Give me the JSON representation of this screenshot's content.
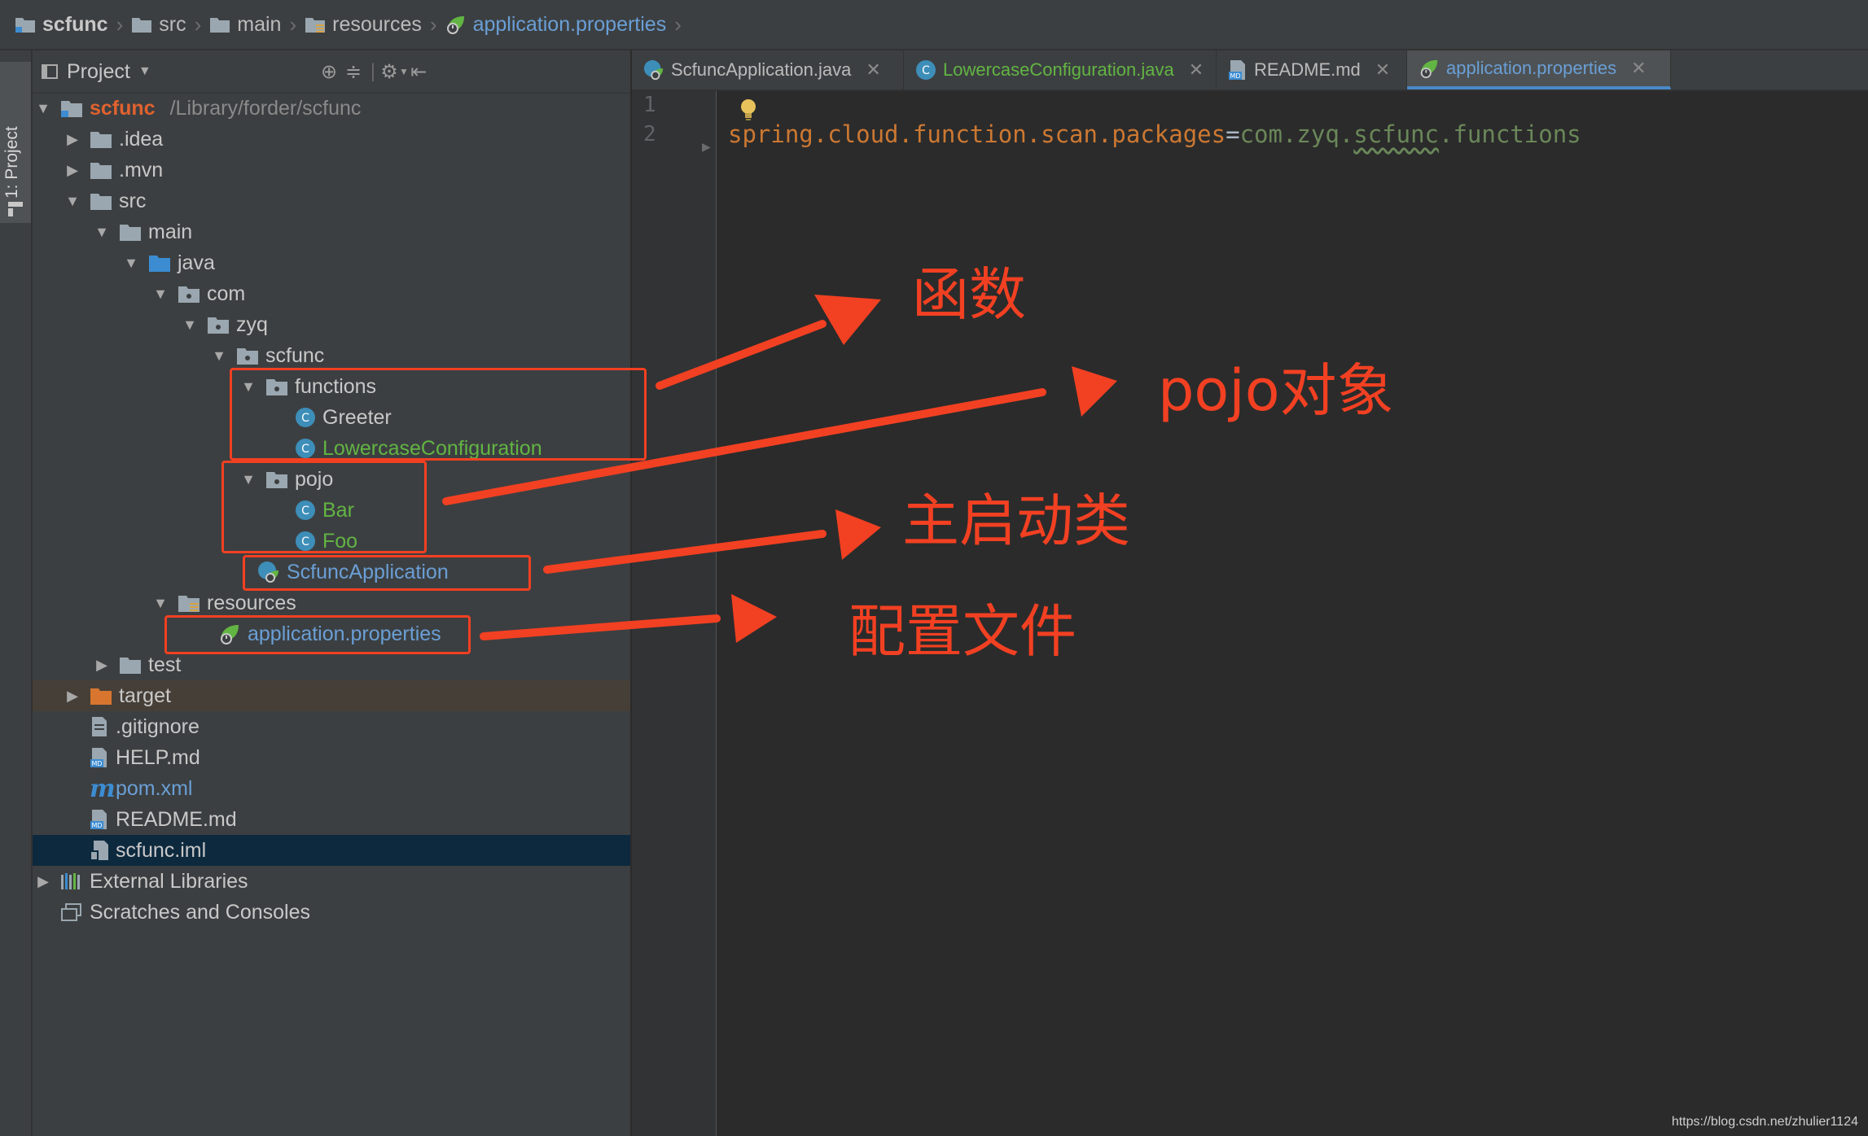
{
  "breadcrumb": {
    "items": [
      "scfunc",
      "src",
      "main",
      "resources",
      "application.properties"
    ]
  },
  "tool_strip": {
    "label": "1: Project"
  },
  "project_panel": {
    "title": "Project"
  },
  "tree": [
    {
      "label": "scfunc",
      "path": "/Library/forder/scfunc"
    },
    {
      "label": ".idea"
    },
    {
      "label": ".mvn"
    },
    {
      "label": "src"
    },
    {
      "label": "main"
    },
    {
      "label": "java"
    },
    {
      "label": "com"
    },
    {
      "label": "zyq"
    },
    {
      "label": "scfunc"
    },
    {
      "label": "functions"
    },
    {
      "label": "Greeter"
    },
    {
      "label": "LowercaseConfiguration"
    },
    {
      "label": "pojo"
    },
    {
      "label": "Bar"
    },
    {
      "label": "Foo"
    },
    {
      "label": "ScfuncApplication"
    },
    {
      "label": "resources"
    },
    {
      "label": "application.properties"
    },
    {
      "label": "test"
    },
    {
      "label": "target"
    },
    {
      "label": ".gitignore"
    },
    {
      "label": "HELP.md"
    },
    {
      "label": "pom.xml"
    },
    {
      "label": "README.md"
    },
    {
      "label": "scfunc.iml"
    },
    {
      "label": "External Libraries"
    },
    {
      "label": "Scratches and Consoles"
    }
  ],
  "tabs": [
    {
      "label": "ScfuncApplication.java"
    },
    {
      "label": "LowercaseConfiguration.java"
    },
    {
      "label": "README.md"
    },
    {
      "label": "application.properties"
    }
  ],
  "editor": {
    "line_numbers": [
      "1",
      "2"
    ],
    "code": {
      "key": "spring.cloud.function.scan.packages",
      "eq": "=",
      "value_a": "com.zyq.",
      "value_b": "scfunc",
      "value_c": ".functions"
    }
  },
  "annotations": {
    "functions": "函数",
    "pojo": "pojo对象",
    "main_class": "主启动类",
    "config": "配置文件"
  },
  "watermark": "https://blog.csdn.net/zhulier1124",
  "colors": {
    "annotation": "#f24022",
    "accent_blue": "#6a9fd6",
    "spring_green": "#62b543"
  }
}
